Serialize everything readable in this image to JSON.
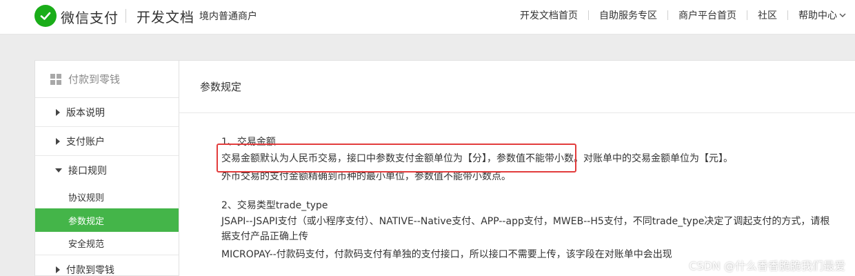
{
  "header": {
    "brand": "微信支付",
    "docs_title": "开发文档",
    "merchant_type": "境内普通商户",
    "nav": [
      "开发文档首页",
      "自助服务专区",
      "商户平台首页",
      "社区",
      "帮助中心"
    ],
    "nav_trailing_icon": "chevron-down-icon"
  },
  "sidebar": {
    "header_label": "付款到零钱",
    "items": [
      {
        "label": "版本说明",
        "state": "collapsed"
      },
      {
        "label": "支付账户",
        "state": "collapsed"
      },
      {
        "label": "接口规则",
        "state": "expanded"
      }
    ],
    "sub_items": [
      {
        "label": "协议规则",
        "active": false
      },
      {
        "label": "参数规定",
        "active": true
      },
      {
        "label": "安全规范",
        "active": false
      }
    ],
    "bottom_item": {
      "label": "付款到零钱",
      "state": "collapsed"
    }
  },
  "main": {
    "title": "参数规定",
    "section1_title": "1、交易金额",
    "section1_line1": "交易金额默认为人民币交易，接口中参数支付金额单位为【分】，参数值不能带小数。对账单中的交易金额单位为【元】。",
    "section1_line2": "外币交易的支付金额精确到币种的最小单位，参数值不能带小数点。",
    "section2_title": "2、交易类型trade_type",
    "section2_line1": "JSAPI--JSAPI支付（或小程序支付）、NATIVE--Native支付、APP--app支付，MWEB--H5支付，不同trade_type决定了调起支付的方式，请根",
    "section2_line2": "据支付产品正确上传",
    "section2_line3": "MICROPAY--付款码支付，付款码支付有单独的支付接口，所以接口不需要上传，该字段在对账单中会出现"
  },
  "watermark": "CSDN @什么香香脆脆我们最爱",
  "colors": {
    "brand_green": "#1aad19",
    "active_green": "#44b549",
    "highlight_red": "#e23b3b"
  }
}
